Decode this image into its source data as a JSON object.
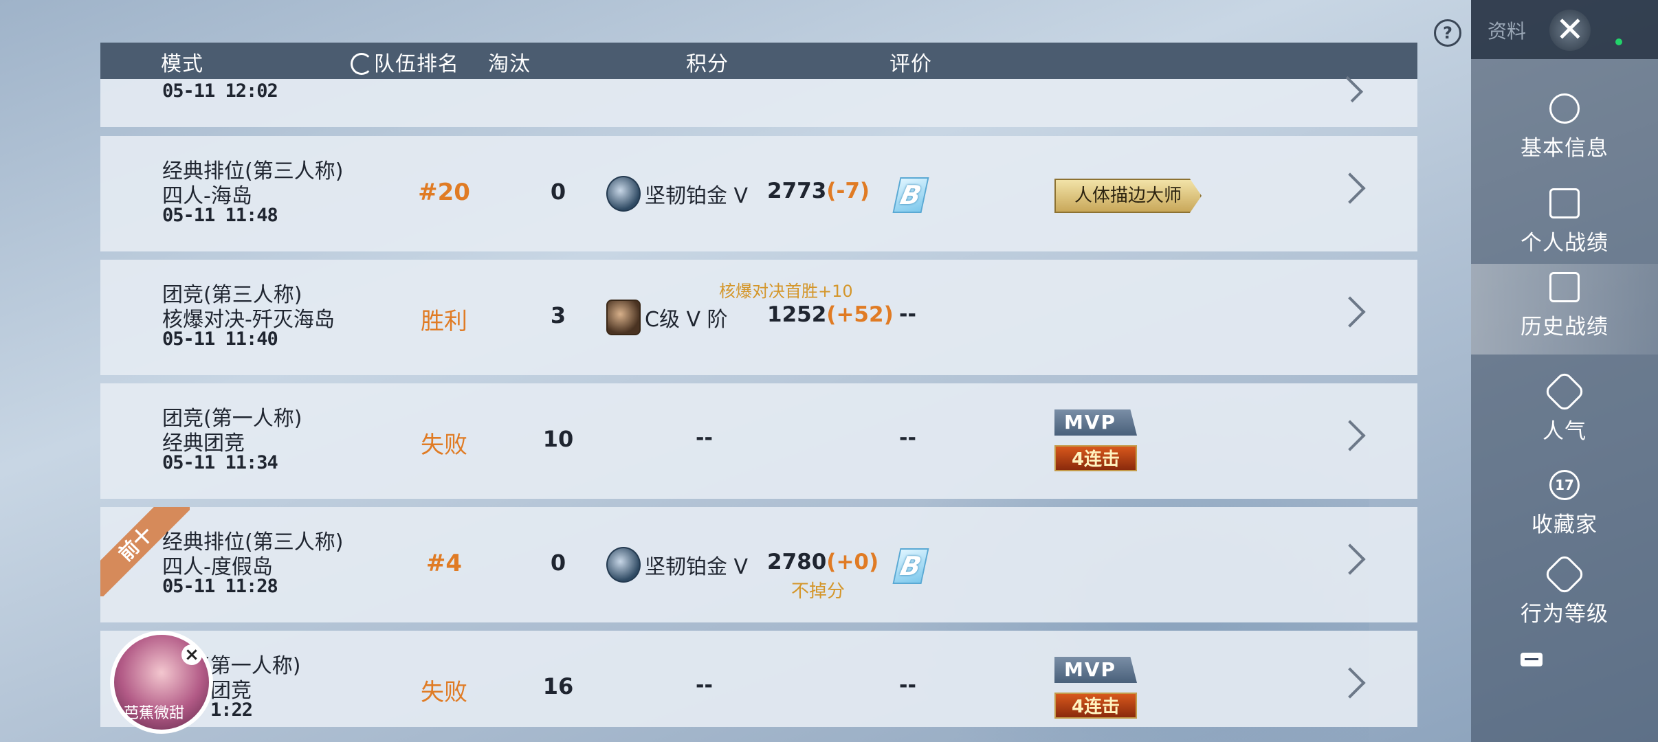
{
  "header": {
    "mode": "模式",
    "team_rank": "队伍排名",
    "kills": "淘汰",
    "score": "积分",
    "rating": "评价"
  },
  "rows": [
    {
      "time": "05-11 12:02"
    },
    {
      "title": "经典排位(第三人称)",
      "sub": "四人-海岛",
      "time": "05-11 11:48",
      "rank": "#20",
      "kills": "0",
      "tier": "坚韧铂金 V",
      "score": "2773",
      "delta": "(-7)",
      "grade": "B",
      "badge": "人体描边大师"
    },
    {
      "title": "团竞(第三人称)",
      "sub": "核爆对决-歼灭海岛",
      "time": "05-11 11:40",
      "rank": "胜利",
      "kills": "3",
      "tier": "C级 V 阶",
      "score": "1252",
      "delta": "(+52)",
      "note": "核爆对决首胜+10",
      "grade": "--"
    },
    {
      "title": "团竞(第一人称)",
      "sub": "经典团竞",
      "time": "05-11 11:34",
      "rank": "失败",
      "kills": "10",
      "score": "--",
      "grade": "--",
      "mvp": "MVP",
      "streak": "4连击"
    },
    {
      "ribbon": "前十",
      "title": "经典排位(第三人称)",
      "sub": "四人-度假岛",
      "time": "05-11 11:28",
      "rank": "#4",
      "kills": "0",
      "tier": "坚韧铂金 V",
      "score": "2780",
      "delta": "(+0)",
      "sub_note": "不掉分",
      "grade": "B"
    },
    {
      "title": "(第一人称)",
      "sub": "团竞",
      "time": "1:22",
      "rank": "失败",
      "kills": "16",
      "score": "--",
      "grade": "--",
      "mvp": "MVP",
      "streak": "4连击"
    }
  ],
  "topbar": {
    "label": "资料",
    "close": "✕"
  },
  "sidebar": [
    {
      "label": "基本信息",
      "icon": "person-icon"
    },
    {
      "label": "个人战绩",
      "icon": "chart-doc-icon"
    },
    {
      "label": "历史战绩",
      "icon": "history-doc-icon",
      "active": true
    },
    {
      "label": "人气",
      "icon": "popularity-icon"
    },
    {
      "label": "收藏家",
      "icon": "collector-icon",
      "badge": "17"
    },
    {
      "label": "行为等级",
      "icon": "behavior-icon"
    }
  ],
  "help": "?",
  "avatar": {
    "text": "芭蕉微甜",
    "close": "×"
  }
}
